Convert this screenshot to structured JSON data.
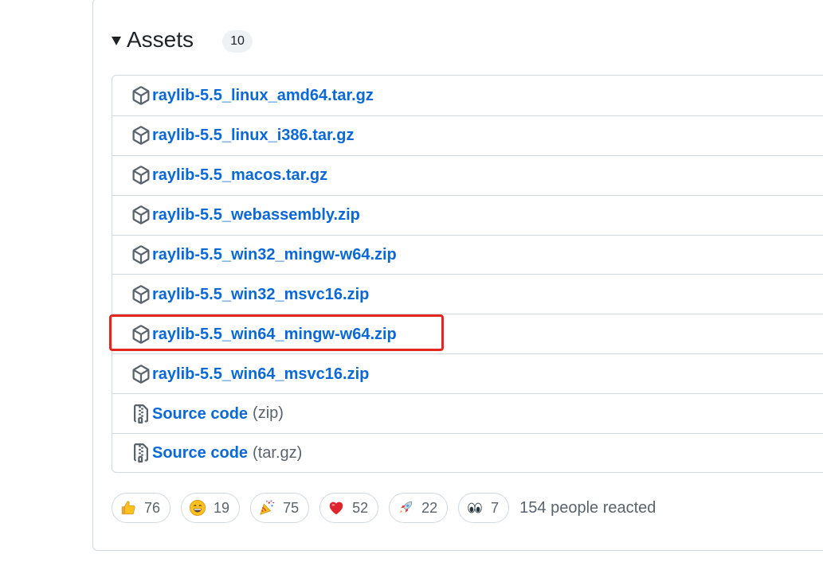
{
  "assets": {
    "title": "Assets",
    "count": "10",
    "items": [
      {
        "name": "raylib-5.5_linux_amd64.tar.gz",
        "suffix": "",
        "icon": "package-icon"
      },
      {
        "name": "raylib-5.5_linux_i386.tar.gz",
        "suffix": "",
        "icon": "package-icon"
      },
      {
        "name": "raylib-5.5_macos.tar.gz",
        "suffix": "",
        "icon": "package-icon"
      },
      {
        "name": "raylib-5.5_webassembly.zip",
        "suffix": "",
        "icon": "package-icon"
      },
      {
        "name": "raylib-5.5_win32_mingw-w64.zip",
        "suffix": "",
        "icon": "package-icon"
      },
      {
        "name": "raylib-5.5_win32_msvc16.zip",
        "suffix": "",
        "icon": "package-icon"
      },
      {
        "name": "raylib-5.5_win64_mingw-w64.zip",
        "suffix": "",
        "icon": "package-icon"
      },
      {
        "name": "raylib-5.5_win64_msvc16.zip",
        "suffix": "",
        "icon": "package-icon"
      },
      {
        "name": "Source code",
        "suffix": "(zip)",
        "icon": "file-zip-icon"
      },
      {
        "name": "Source code",
        "suffix": "(tar.gz)",
        "icon": "file-zip-icon"
      }
    ]
  },
  "reactions": {
    "items": [
      {
        "emoji": "thumbs-up-icon",
        "count": "76"
      },
      {
        "emoji": "laugh-icon",
        "count": "19"
      },
      {
        "emoji": "hooray-icon",
        "count": "75"
      },
      {
        "emoji": "heart-icon",
        "count": "52"
      },
      {
        "emoji": "rocket-icon",
        "count": "22"
      },
      {
        "emoji": "eyes-icon",
        "count": "7"
      }
    ],
    "summary": "154 people reacted"
  },
  "colors": {
    "link": "#0969da",
    "highlight": "#e5261f",
    "border": "#d1d9e0",
    "muted": "#59636e"
  }
}
